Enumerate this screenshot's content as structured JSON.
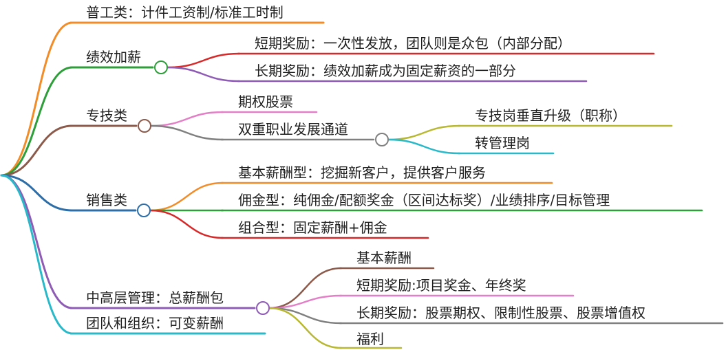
{
  "mindmap": {
    "branches": [
      {
        "label": "普工类：计件工资制/标准工时制",
        "color": "#F28C28"
      },
      {
        "label": "绩效加薪",
        "color": "#2E9E3A",
        "children": [
          {
            "label": "短期奖励：一次性发放，团队则是众包（内部分配）",
            "color": "#D62A2A"
          },
          {
            "label": "长期奖励：绩效加薪成为固定薪资的一部分",
            "color": "#8E5BB5"
          }
        ]
      },
      {
        "label": "专技类",
        "color": "#8B5A4A",
        "children": [
          {
            "label": "期权股票",
            "color": "#E37FC6"
          },
          {
            "label": "双重职业发展通道",
            "color": "#808080",
            "children": [
              {
                "label": "专技岗垂直升级（职称）",
                "color": "#B8B832"
              },
              {
                "label": "转管理岗",
                "color": "#29B9C9"
              }
            ]
          }
        ]
      },
      {
        "label": "销售类",
        "color": "#2E6EA8",
        "children": [
          {
            "label": "基本薪酬型：挖掘新客户，提供客户服务",
            "color": "#F28C28"
          },
          {
            "label": "佣金型：纯佣金/配额奖金（区间达标奖）/业绩排序/目标管理",
            "color": "#2E9E3A"
          },
          {
            "label": "组合型：固定薪酬+佣金",
            "color": "#D62A2A"
          }
        ]
      },
      {
        "label": "中高层管理：总薪酬包",
        "color": "#8E5BB5",
        "children": [
          {
            "label": "基本薪酬",
            "color": "#8B5A4A"
          },
          {
            "label": "短期奖励:项目奖金、年终奖",
            "color": "#E37FC6"
          },
          {
            "label": "长期奖励：股票期权、限制性股票、股票增值权",
            "color": "#808080"
          },
          {
            "label": "福利",
            "color": "#B8B832"
          }
        ]
      },
      {
        "label": "团队和组织：可变薪酬",
        "color": "#29B9C9"
      }
    ]
  }
}
